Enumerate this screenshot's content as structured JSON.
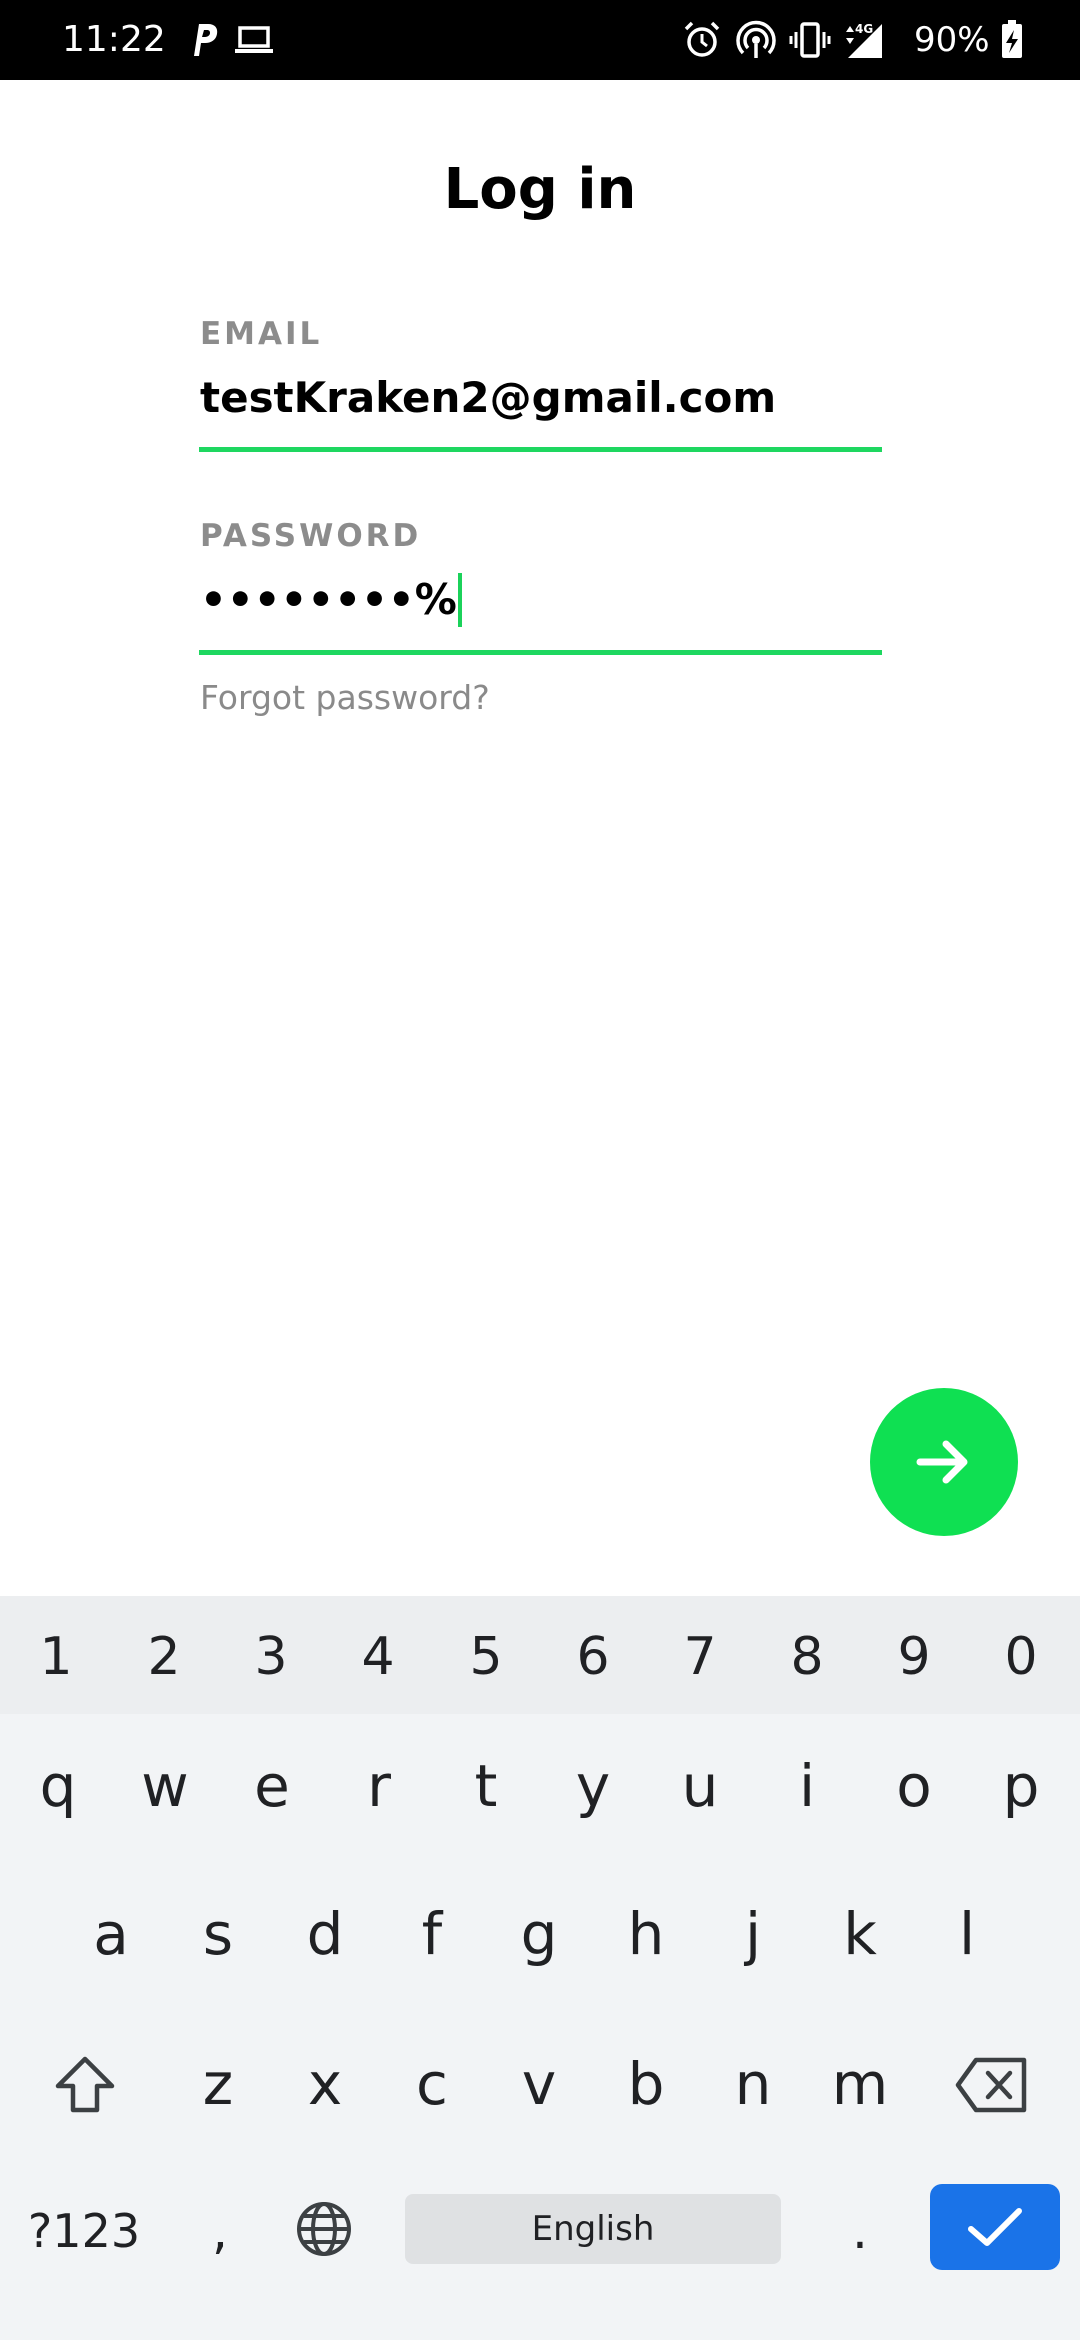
{
  "status_bar": {
    "time": "11:22",
    "battery": "90%",
    "icons": [
      "parking-app-icon",
      "laptop-icon",
      "alarm-icon",
      "hotspot-icon",
      "vibrate-icon",
      "signal-4g-icon",
      "battery-charging-icon"
    ],
    "network_label": "4G"
  },
  "page": {
    "title": "Log in"
  },
  "email": {
    "label": "EMAIL",
    "value": "testKraken2@gmail.com"
  },
  "password": {
    "label": "PASSWORD",
    "value": "••••••••%"
  },
  "forgot_link": "Forgot password?",
  "next_button": {
    "icon": "arrow-right-icon",
    "color": "#0fe052"
  },
  "colors": {
    "accent": "#1ed760",
    "label_gray": "#8c8c8c",
    "keyboard_bg": "#f2f4f6",
    "enter_key": "#1a73e8"
  },
  "keyboard": {
    "numbers": [
      "1",
      "2",
      "3",
      "4",
      "5",
      "6",
      "7",
      "8",
      "9",
      "0"
    ],
    "row1": [
      "q",
      "w",
      "e",
      "r",
      "t",
      "y",
      "u",
      "i",
      "o",
      "p"
    ],
    "row2": [
      "a",
      "s",
      "d",
      "f",
      "g",
      "h",
      "j",
      "k",
      "l"
    ],
    "row3": [
      "z",
      "x",
      "c",
      "v",
      "b",
      "n",
      "m"
    ],
    "mode_key": "?123",
    "comma": ",",
    "space_label": "English",
    "period": ".",
    "icons": [
      "shift-icon",
      "backspace-icon",
      "globe-icon",
      "checkmark-icon"
    ]
  }
}
